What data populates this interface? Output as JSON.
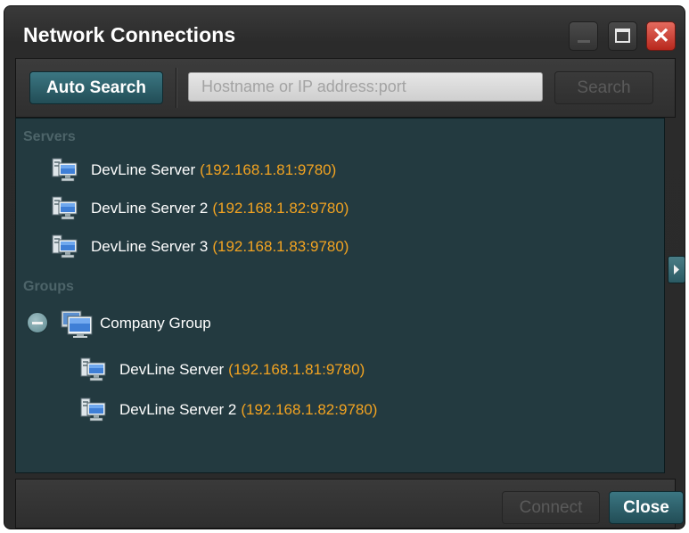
{
  "window": {
    "title": "Network Connections"
  },
  "toolbar": {
    "auto_search_label": "Auto Search",
    "search_placeholder": "Hostname or IP address:port",
    "search_value": "",
    "search_label": "Search"
  },
  "servers": {
    "label": "Servers",
    "items": [
      {
        "name": "DevLine Server",
        "address": "(192.168.1.81:9780)"
      },
      {
        "name": "DevLine Server 2",
        "address": "(192.168.1.82:9780)"
      },
      {
        "name": "DevLine Server 3",
        "address": "(192.168.1.83:9780)"
      }
    ]
  },
  "groups": {
    "label": "Groups",
    "items": [
      {
        "name": "Company Group",
        "expanded": true,
        "servers": [
          {
            "name": "DevLine Server",
            "address": "(192.168.1.81:9780)"
          },
          {
            "name": "DevLine Server 2",
            "address": "(192.168.1.82:9780)"
          }
        ]
      }
    ]
  },
  "footer": {
    "connect_label": "Connect",
    "close_label": "Close"
  },
  "colors": {
    "accent": "#2d6470",
    "panel_background": "#233a40",
    "address_text": "#f2a321",
    "close_button": "#c2362a"
  },
  "icons": [
    "minimize-icon",
    "maximize-icon",
    "close-icon",
    "server-icon",
    "group-icon",
    "collapse-icon",
    "expand-panel-icon"
  ]
}
